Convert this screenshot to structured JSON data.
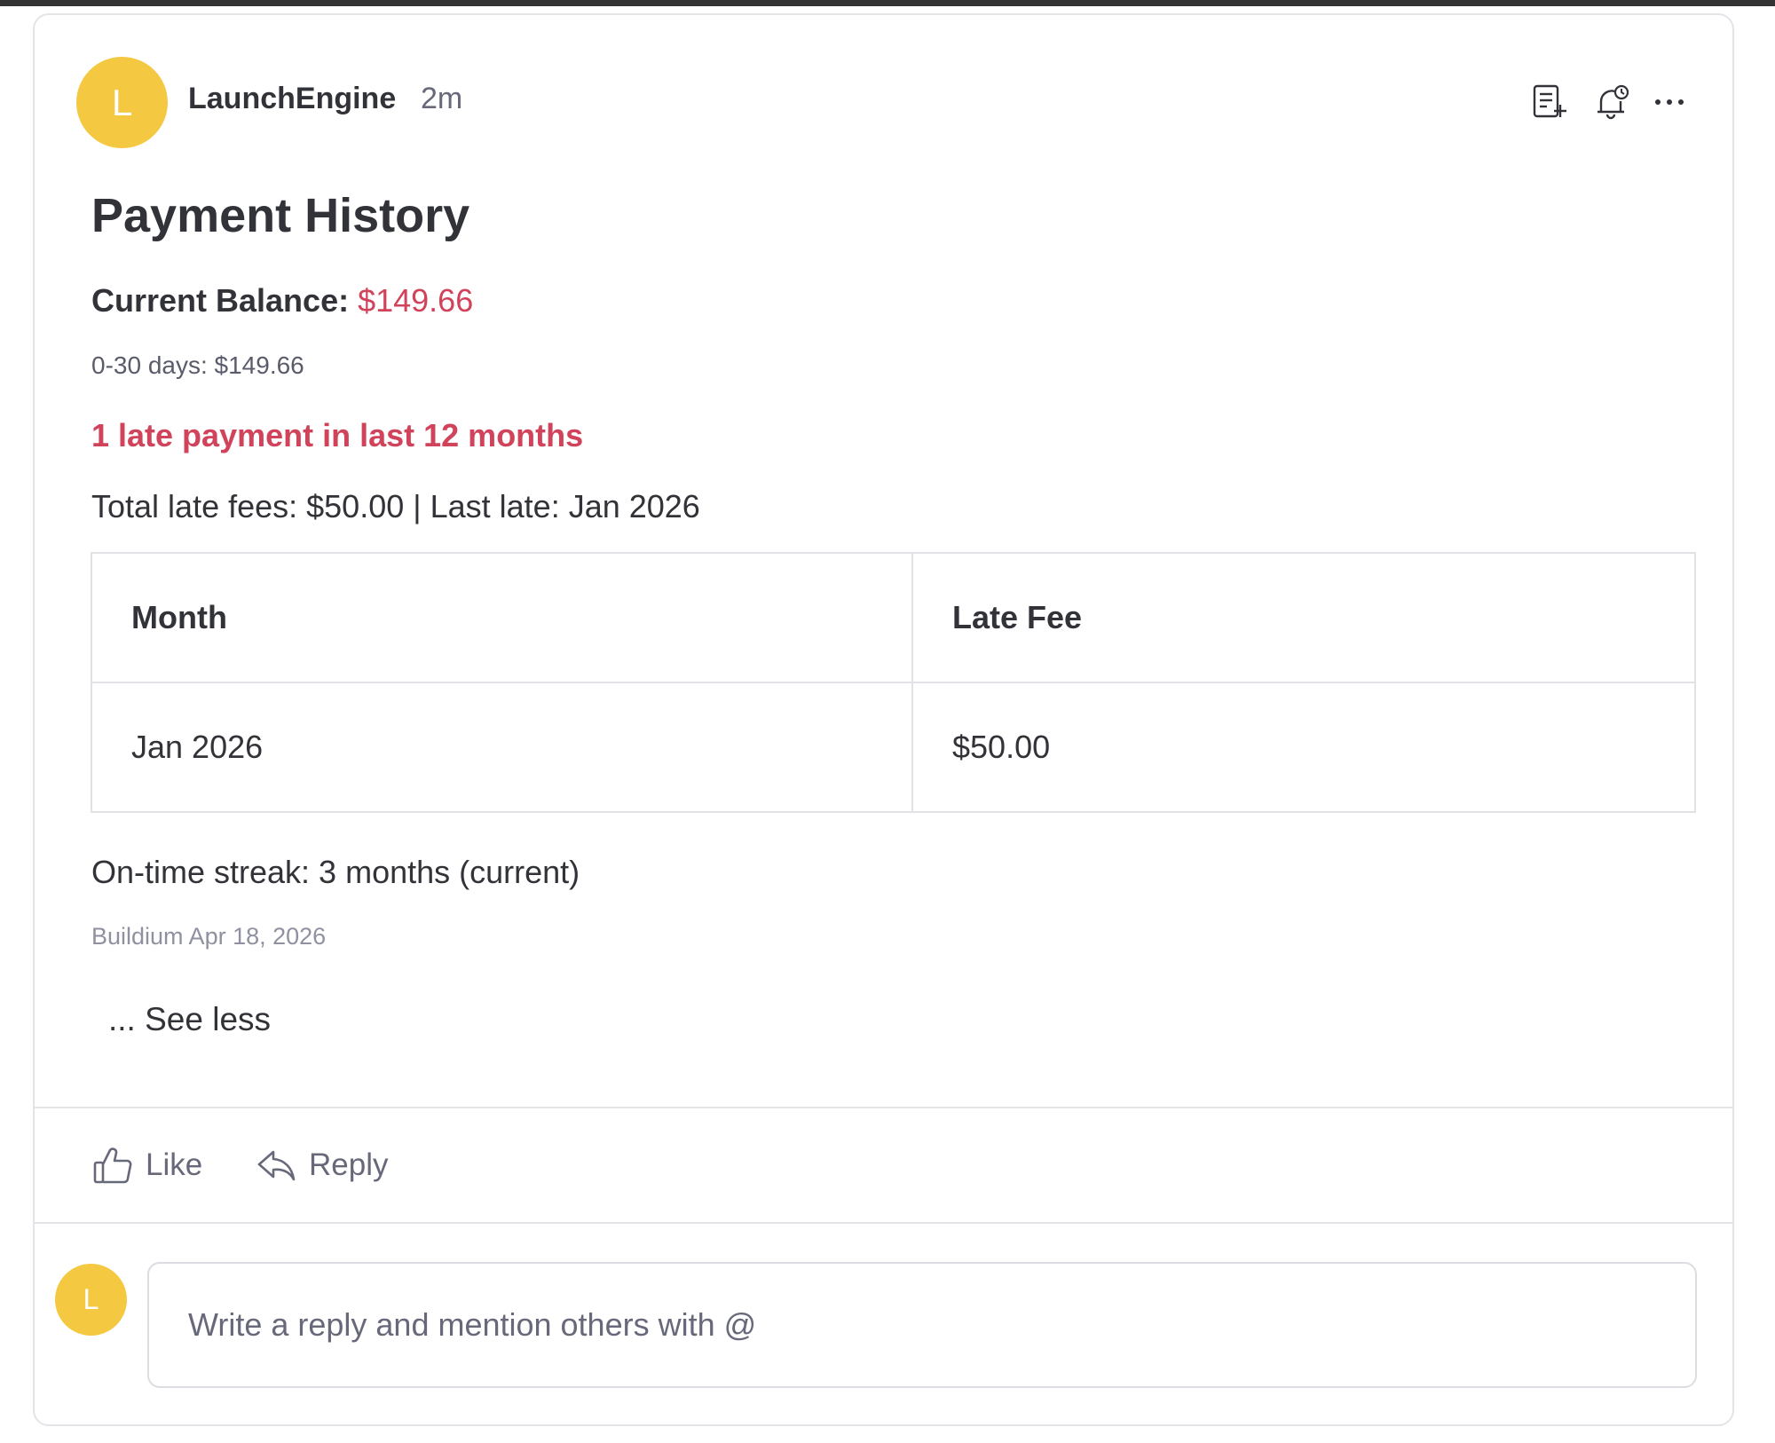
{
  "post": {
    "avatar_letter": "L",
    "author": "LaunchEngine",
    "time": "2m",
    "title": "Payment History",
    "balance_label": "Current Balance:",
    "balance_amount": "$149.66",
    "aging": "0-30 days: $149.66",
    "late_alert": "1 late payment in last 12 months",
    "totals": "Total late fees: $50.00 | Last late: Jan 2026",
    "table": {
      "headers": [
        "Month",
        "Late Fee"
      ],
      "rows": [
        [
          "Jan 2026",
          "$50.00"
        ]
      ]
    },
    "streak": "On-time streak: 3 months (current)",
    "source": "Buildium Apr 18, 2026",
    "see_less": "... See less"
  },
  "actions": {
    "like": "Like",
    "reply": "Reply"
  },
  "reply_box": {
    "avatar_letter": "L",
    "placeholder": "Write a reply and mention others with @"
  },
  "colors": {
    "avatar": "#f5c842",
    "accent_red": "#d0435a"
  },
  "icons": [
    "zoom-out-icon",
    "add-to-board-icon",
    "reminder-bell-icon",
    "more-options-icon",
    "thumbs-up-icon",
    "reply-arrow-icon"
  ]
}
